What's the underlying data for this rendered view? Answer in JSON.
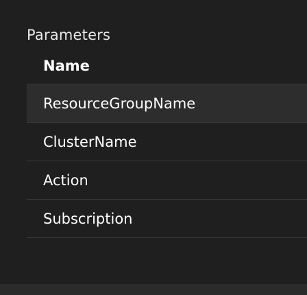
{
  "section": {
    "title": "Parameters"
  },
  "table": {
    "header": "Name",
    "rows": [
      {
        "name": "ResourceGroupName",
        "selected": true
      },
      {
        "name": "ClusterName",
        "selected": false
      },
      {
        "name": "Action",
        "selected": false
      },
      {
        "name": "Subscription",
        "selected": false
      }
    ]
  }
}
